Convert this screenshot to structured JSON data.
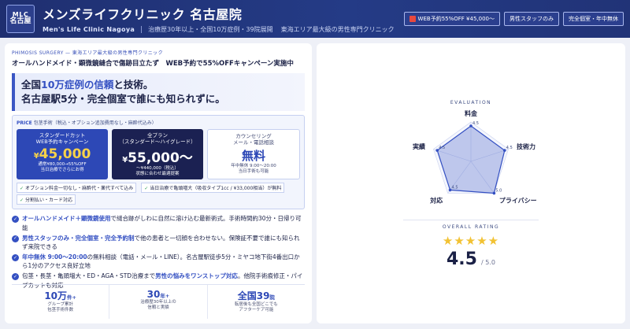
{
  "header": {
    "logo_top": "MLC",
    "logo_bottom": "名古屋",
    "title": "メンズライフクリニック 名古屋院",
    "subtitle_en": "Men's Life Clinic Nagoya",
    "tagline1": "治療歴30年以上・全国10万症例・39院展開",
    "tagline2": "東海エリア最大級の男性専門クリニック",
    "badges": [
      {
        "label": "WEB予約55%OFF ¥45,000〜",
        "icon": "gift-icon"
      },
      {
        "label": "男性スタッフのみ"
      },
      {
        "label": "完全個室・年中無休"
      }
    ]
  },
  "left": {
    "kicker": "PHIMOSIS SURGERY — 東海エリア最大級の男性専門クリニック",
    "lead": "オールハンドメイド・顕微鏡縫合で傷跡目立たず　WEB予約で55%OFFキャンペーン実施中",
    "hero": {
      "l1_pre": "全国",
      "l1_hl": "10万症例の信頼",
      "l1_post": "と技術。",
      "l2": "名古屋駅5分・完全個室で誰にも知られずに。"
    },
    "price": {
      "label": "PRICE",
      "desc": "包茎手術（税込・オプション追加費用なし・麻酔代込み）",
      "cards": [
        {
          "t1": "スタンダードカット",
          "t2": "WEB予約キャンペーン",
          "yen": "¥",
          "amount": "45,000",
          "n1": "通常¥80,000→55%OFF",
          "n2": "当日治療でさらにお得"
        },
        {
          "t1": "全プラン",
          "t2": "（スタンダード〜ハイグレード）",
          "yen": "¥",
          "amount": "55,000〜",
          "n1": "〜¥440,000（税込）",
          "n2": "状態に合わせ最適提案"
        },
        {
          "t1": "カウンセリング",
          "t2": "メール・電話相談",
          "yen": "",
          "amount": "無料",
          "n1": "年中無休 9:00〜20:00",
          "n2": "当日手術も可能"
        }
      ],
      "notes": [
        "オプション料金一切なし・麻酔代・薬代すべて込み",
        "当日治療で亀頭増大（吸収タイプ1cc / ¥33,000相当）が無料",
        "分割払い・カード対応"
      ]
    },
    "features": [
      {
        "em": "オールハンドメイド＋顕微鏡使用",
        "text": "で縫合跡がしわに自然に溶け込む最新術式。手術時間約30分・日帰り可能"
      },
      {
        "em": "男性スタッフのみ・完全個室・完全予約制",
        "text": "で他の患者と一切顔を合わせない。保険証不要で誰にも知られず来院できる"
      },
      {
        "em": "年中無休 9:00〜20:00",
        "text": "の無料相談（電話・メール・LINE）。名古屋駅徒歩5分・ミヤコ地下街4番出口から1分のアクセス良好立地"
      },
      {
        "em": "",
        "text": "包茎・長茎・亀頭増大・ED・AGA・STD治療まで",
        "em2": "男性の悩みをワンストップ対応",
        "text2": "。他院手術痕修正・パイプカットも対応"
      }
    ],
    "stats": [
      {
        "value": "10万",
        "unit": "件+",
        "d1": "グループ累計",
        "d2": "包茎手術件数"
      },
      {
        "value": "30",
        "unit": "年+",
        "d1": "治療歴30年以上の",
        "d2": "信頼と実績"
      },
      {
        "value": "全国39",
        "unit": "院",
        "d1": "転居後も全国どこでも",
        "d2": "アフターケア可能"
      }
    ]
  },
  "right": {
    "eval_title": "EVALUATION",
    "radar": [
      {
        "label": "料金",
        "value": 4.5
      },
      {
        "label": "技術力",
        "value": 4.5
      },
      {
        "label": "プライバシー",
        "value": 5.0
      },
      {
        "label": "対応",
        "value": 4.5
      },
      {
        "label": "実績",
        "value": 4.5
      }
    ],
    "radar_max": 5,
    "overall_title": "OVERALL RATING",
    "stars": "★★★★★",
    "score": "4.5",
    "score_max": "/ 5.0"
  },
  "colors": {
    "accent": "#3450c2",
    "header": "#243b86",
    "price": "#f7d24a"
  }
}
